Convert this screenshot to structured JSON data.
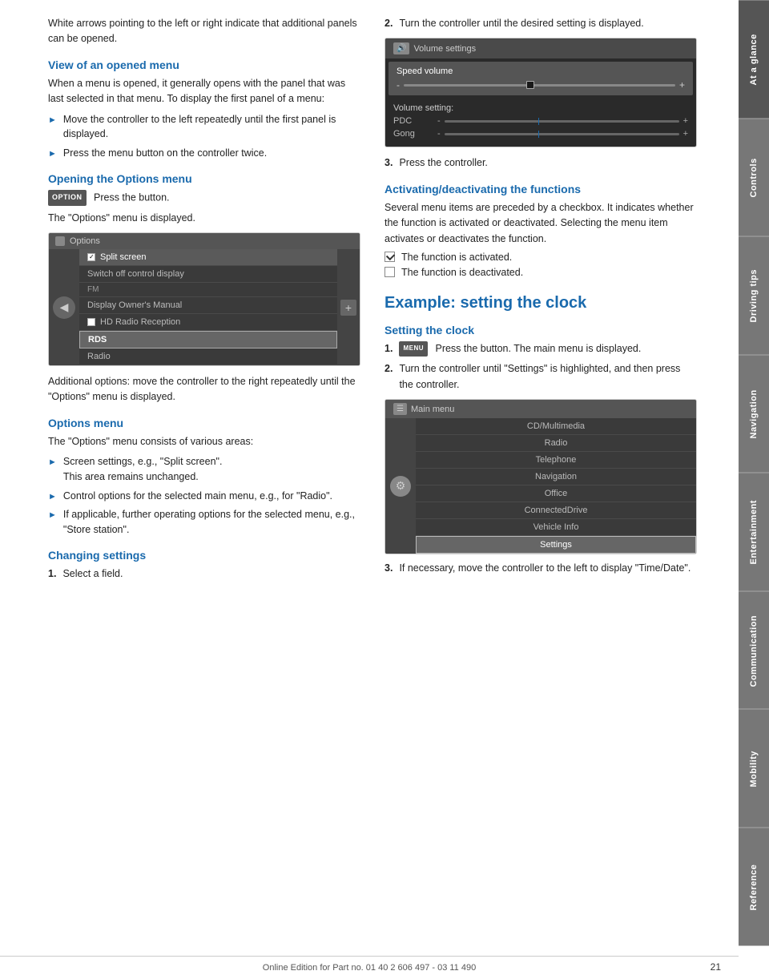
{
  "sidebar": {
    "tabs": [
      {
        "label": "At a glance",
        "active": true
      },
      {
        "label": "Controls",
        "active": false
      },
      {
        "label": "Driving tips",
        "active": false
      },
      {
        "label": "Navigation",
        "active": false
      },
      {
        "label": "Entertainment",
        "active": false
      },
      {
        "label": "Communication",
        "active": false
      },
      {
        "label": "Mobility",
        "active": false
      },
      {
        "label": "Reference",
        "active": false
      }
    ]
  },
  "left_col": {
    "intro_para": "White arrows pointing to the left or right indicate that additional panels can be opened.",
    "section1": {
      "heading": "View of an opened menu",
      "para": "When a menu is opened, it generally opens with the panel that was last selected in that menu. To display the first panel of a menu:",
      "bullets": [
        "Move the controller to the left repeatedly until the first panel is displayed.",
        "Press the menu button on the controller twice."
      ]
    },
    "section2": {
      "heading": "Opening the Options menu",
      "btn_label": "OPTION",
      "btn_text": "Press the button.",
      "caption": "The \"Options\" menu is displayed.",
      "options_screen": {
        "title": "Options",
        "items": [
          {
            "type": "checked",
            "label": "Split screen"
          },
          {
            "type": "plain",
            "label": "Switch off control display"
          },
          {
            "type": "section",
            "label": "FM"
          },
          {
            "type": "plain",
            "label": "Display Owner's Manual"
          },
          {
            "type": "checkbox",
            "label": "HD Radio Reception"
          },
          {
            "type": "highlighted_box",
            "label": "RDS"
          },
          {
            "type": "plain",
            "label": "Radio"
          }
        ]
      },
      "additional_options": "Additional options: move the controller to the right repeatedly until the \"Options\" menu is displayed."
    },
    "section3": {
      "heading": "Options menu",
      "para": "The \"Options\" menu consists of various areas:",
      "bullets": [
        {
          "text": "Screen settings, e.g., \"Split screen\".",
          "sub": "This area remains unchanged."
        },
        {
          "text": "Control options for the selected main menu, e.g., for \"Radio\"."
        },
        {
          "text": "If applicable, further operating options for the selected menu, e.g., \"Store station\"."
        }
      ]
    },
    "section4": {
      "heading": "Changing settings",
      "numbered": [
        {
          "num": "1.",
          "text": "Select a field."
        }
      ]
    }
  },
  "right_col": {
    "numbered_items": [
      {
        "num": "2.",
        "text": "Turn the controller until the desired setting is displayed."
      }
    ],
    "volume_screen": {
      "title": "Volume settings",
      "speed_volume": "Speed volume",
      "settings_label": "Volume setting:",
      "settings": [
        {
          "label": "PDC"
        },
        {
          "label": "Gong"
        }
      ]
    },
    "step3": "Press the controller.",
    "section_activate": {
      "heading": "Activating/deactivating the functions",
      "para": "Several menu items are preceded by a checkbox. It indicates whether the function is activated or deactivated. Selecting the menu item activates or deactivates the function.",
      "check_active_label": "The function is activated.",
      "check_inactive_label": "The function is deactivated."
    },
    "section_example": {
      "heading_large": "Example: setting the clock",
      "heading_sub": "Setting the clock",
      "numbered": [
        {
          "num": "1.",
          "btn_label": "MENU",
          "text": "Press the button. The main menu is displayed."
        },
        {
          "num": "2.",
          "text": "Turn the controller until \"Settings\" is highlighted, and then press the controller."
        }
      ],
      "main_menu_screen": {
        "title": "Main menu",
        "items": [
          "CD/Multimedia",
          "Radio",
          "Telephone",
          "Navigation",
          "Office",
          "ConnectedDrive",
          "Vehicle Info",
          "Settings"
        ]
      },
      "step3": "If necessary, move the controller to the left to display \"Time/Date\"."
    }
  },
  "footer": {
    "text": "Online Edition for Part no. 01 40 2 606 497 - 03 11 490",
    "page_number": "21"
  }
}
